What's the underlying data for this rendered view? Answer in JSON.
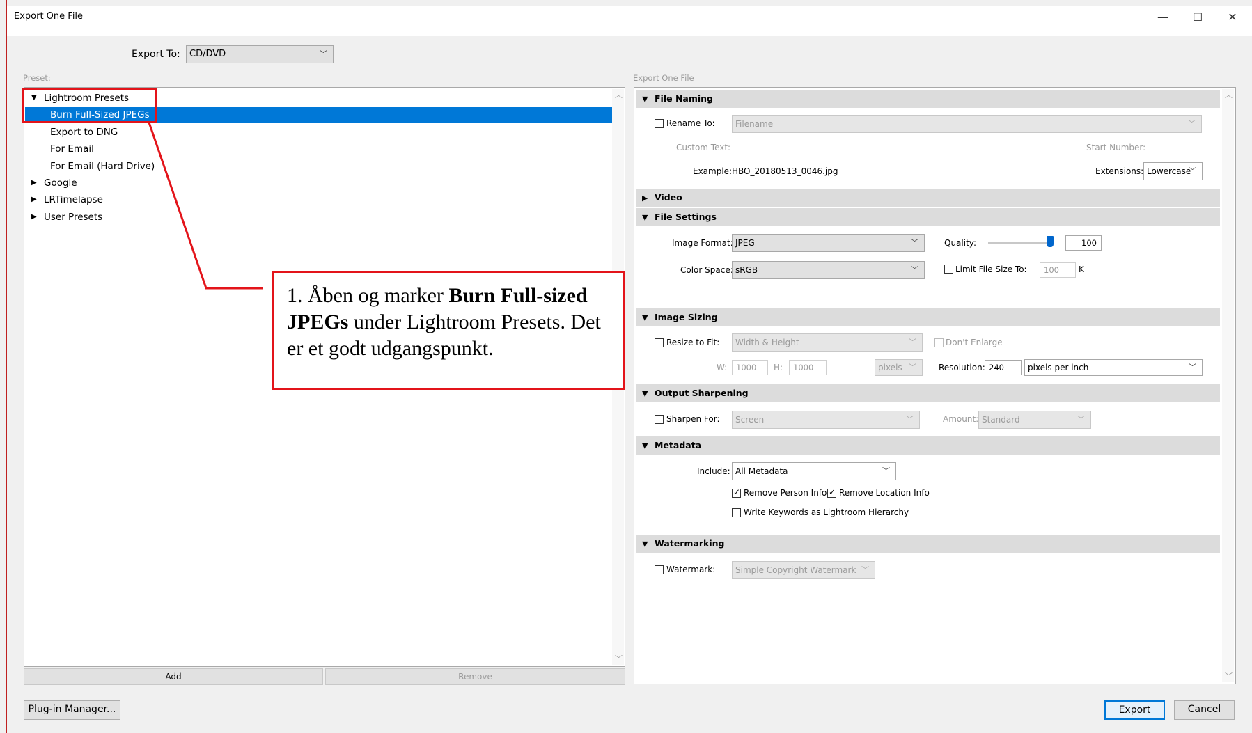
{
  "window": {
    "title": "Export One File",
    "controls": {
      "minimize": "—",
      "maximize": "☐",
      "close": "✕"
    }
  },
  "export_to": {
    "label": "Export To:",
    "value": "CD/DVD"
  },
  "preset": {
    "label": "Preset:",
    "groups": [
      {
        "name": "Lightroom Presets",
        "expanded": true,
        "items": [
          "Burn Full-Sized JPEGs",
          "Export to DNG",
          "For Email",
          "For Email (Hard Drive)"
        ]
      },
      {
        "name": "Google",
        "expanded": false
      },
      {
        "name": "LRTimelapse",
        "expanded": false
      },
      {
        "name": "User Presets",
        "expanded": false
      }
    ],
    "selected": "Burn Full-Sized JPEGs",
    "add_label": "Add",
    "remove_label": "Remove"
  },
  "right_panel": {
    "label": "Export One File"
  },
  "file_naming": {
    "title": "File Naming",
    "rename_to_label": "Rename To:",
    "rename_value": "Filename",
    "custom_text_label": "Custom Text:",
    "start_number_label": "Start Number:",
    "example_label": "Example:",
    "example_value": "HBO_20180513_0046.jpg",
    "extensions_label": "Extensions:",
    "extensions_value": "Lowercase"
  },
  "video": {
    "title": "Video"
  },
  "file_settings": {
    "title": "File Settings",
    "image_format_label": "Image Format:",
    "image_format_value": "JPEG",
    "quality_label": "Quality:",
    "quality_value": "100",
    "color_space_label": "Color Space:",
    "color_space_value": "sRGB",
    "limit_label": "Limit File Size To:",
    "limit_value": "100",
    "limit_unit": "K"
  },
  "image_sizing": {
    "title": "Image Sizing",
    "resize_label": "Resize to Fit:",
    "resize_value": "Width & Height",
    "dont_enlarge_label": "Don't Enlarge",
    "w_label": "W:",
    "w_value": "1000",
    "h_label": "H:",
    "h_value": "1000",
    "units_value": "pixels",
    "resolution_label": "Resolution:",
    "resolution_value": "240",
    "resolution_unit": "pixels per inch"
  },
  "output_sharpening": {
    "title": "Output Sharpening",
    "sharpen_label": "Sharpen For:",
    "sharpen_value": "Screen",
    "amount_label": "Amount:",
    "amount_value": "Standard"
  },
  "metadata": {
    "title": "Metadata",
    "include_label": "Include:",
    "include_value": "All Metadata",
    "remove_person_label": "Remove Person Info",
    "remove_location_label": "Remove Location Info",
    "write_keywords_label": "Write Keywords as Lightroom Hierarchy"
  },
  "watermarking": {
    "title": "Watermarking",
    "watermark_label": "Watermark:",
    "watermark_value": "Simple Copyright Watermark"
  },
  "callout": {
    "prefix": "1. Åben og marker ",
    "bold": "Burn Full-sized JPEGs",
    "suffix": " under Lightroom Presets. Det er et godt udgangspunkt."
  },
  "footer": {
    "plugin_manager": "Plug-in Manager...",
    "export": "Export",
    "cancel": "Cancel"
  },
  "colors": {
    "selection": "#0078d7",
    "annotation": "#e3141a"
  }
}
